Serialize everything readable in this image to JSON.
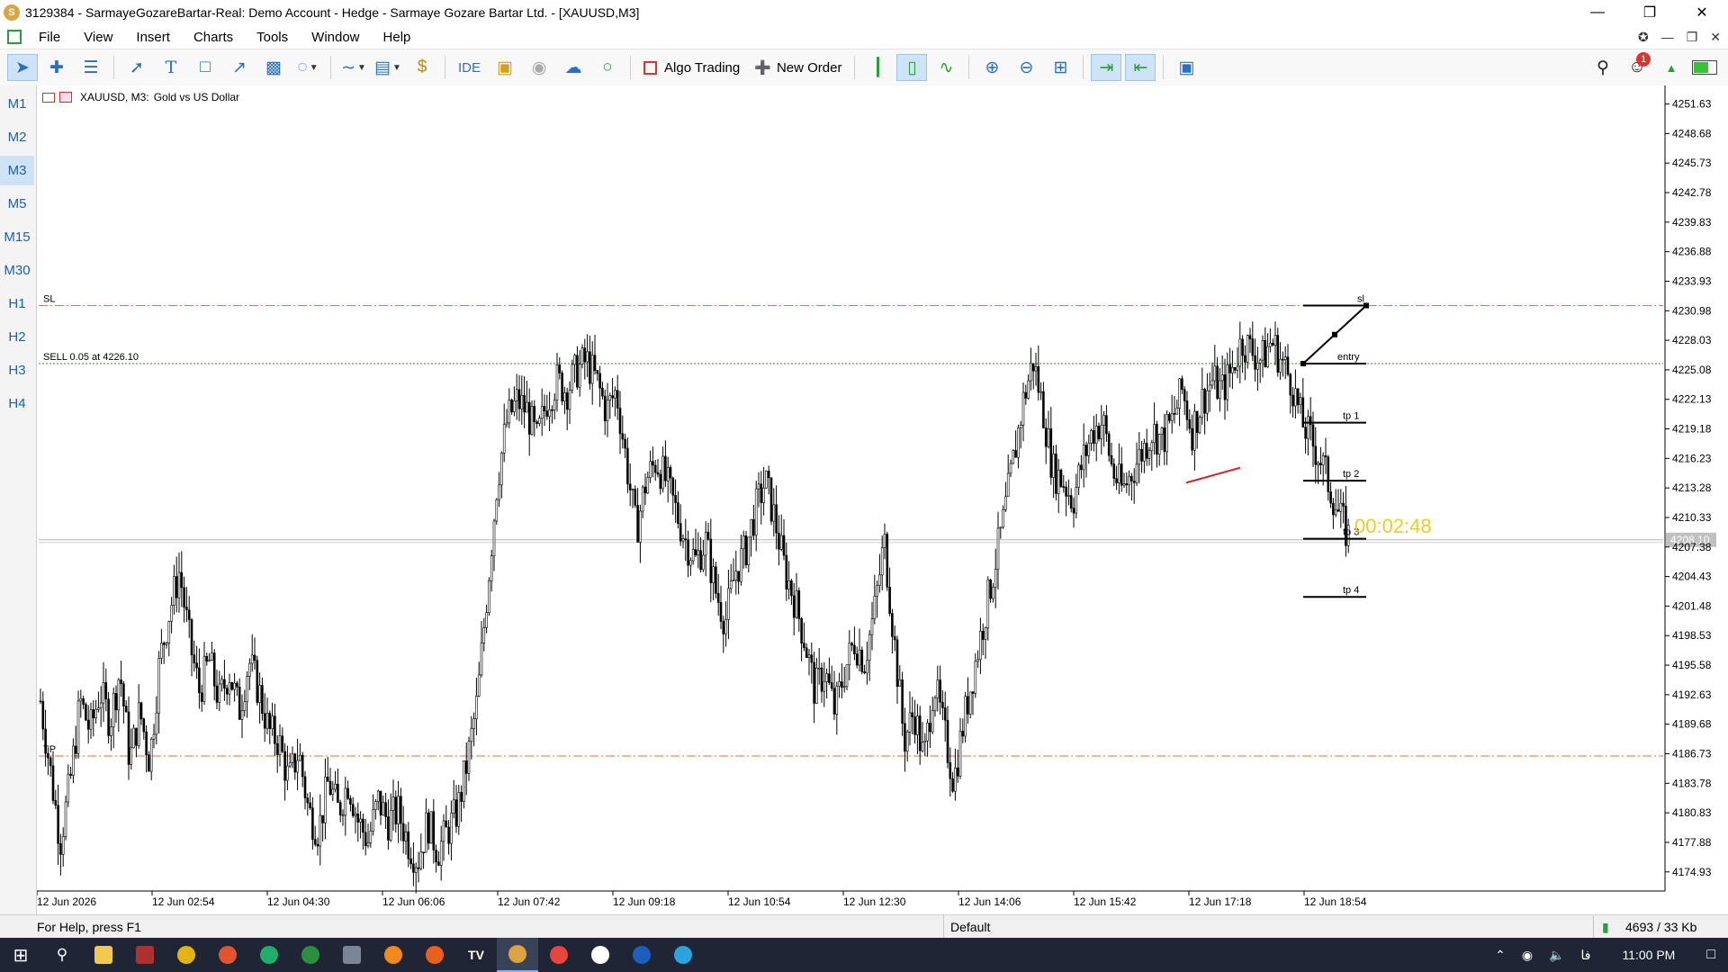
{
  "window": {
    "title": "3129384 - SarmayeGozareBartar-Real: Demo Account - Hedge - Sarmaye Gozare Bartar Ltd. - [XAUUSD,M3]",
    "app_icon": "S"
  },
  "menu": [
    "File",
    "View",
    "Insert",
    "Charts",
    "Tools",
    "Window",
    "Help"
  ],
  "toolbar": {
    "ide_label": "IDE",
    "algo_label": "Algo Trading",
    "order_label": "New Order",
    "notification_count": "1"
  },
  "timeframes": [
    "M1",
    "M2",
    "M3",
    "M5",
    "M15",
    "M30",
    "H1",
    "H2",
    "H3",
    "H4"
  ],
  "active_timeframe": "M3",
  "chart_header": {
    "symbol": "XAUUSD, M3:",
    "description": "Gold vs US Dollar"
  },
  "chart_data": {
    "type": "candlestick",
    "symbol": "XAUUSD",
    "timeframe": "M3",
    "ylim": [
      4173.2,
      4253.3
    ],
    "y_ticks": [
      "4251.63",
      "4248.68",
      "4245.73",
      "4242.78",
      "4239.83",
      "4236.88",
      "4233.93",
      "4230.98",
      "4228.03",
      "4225.08",
      "4222.13",
      "4219.18",
      "4216.23",
      "4213.28",
      "4210.33",
      "4207.38",
      "4204.43",
      "4201.48",
      "4198.53",
      "4195.58",
      "4192.63",
      "4189.68",
      "4186.73",
      "4183.78",
      "4180.83",
      "4177.88",
      "4174.93"
    ],
    "x_ticks": [
      "12 Jun 2026",
      "12 Jun 02:54",
      "12 Jun 04:30",
      "12 Jun 06:06",
      "12 Jun 07:42",
      "12 Jun 09:18",
      "12 Jun 10:54",
      "12 Jun 12:30",
      "12 Jun 14:06",
      "12 Jun 15:42",
      "12 Jun 17:18",
      "12 Jun 18:54"
    ],
    "current_price": "4208.10",
    "bar_countdown": "00:02:48",
    "levels": [
      {
        "label": "SL",
        "price": 4231.5,
        "style": "dashdot",
        "color": "#f26b3a"
      },
      {
        "label": "SELL 0.05 at 4226.10",
        "price": 4225.7,
        "style": "dotted",
        "color": "#2e9a2e"
      },
      {
        "label": "TP",
        "price": 4186.5,
        "style": "dashdot",
        "color": "#f26b3a"
      }
    ],
    "trade_plan_labels": [
      "sl",
      "entry",
      "tp 1",
      "tp 2",
      "tp 3",
      "tp 4"
    ],
    "trade_plan_prices": [
      4231.5,
      4225.7,
      4219.8,
      4214.0,
      4208.2,
      4202.4
    ],
    "price_path": [
      [
        0,
        4192
      ],
      [
        2,
        4185
      ],
      [
        4,
        4178
      ],
      [
        6,
        4184
      ],
      [
        8,
        4192
      ],
      [
        10,
        4189
      ],
      [
        12,
        4193
      ],
      [
        14,
        4190
      ],
      [
        16,
        4195
      ],
      [
        18,
        4186
      ],
      [
        20,
        4191
      ],
      [
        22,
        4186
      ],
      [
        24,
        4196
      ],
      [
        26,
        4201
      ],
      [
        28,
        4205
      ],
      [
        30,
        4198
      ],
      [
        32,
        4193
      ],
      [
        34,
        4196
      ],
      [
        36,
        4192
      ],
      [
        38,
        4195
      ],
      [
        40,
        4191
      ],
      [
        42,
        4196
      ],
      [
        44,
        4193
      ],
      [
        46,
        4189
      ],
      [
        48,
        4188
      ],
      [
        50,
        4184
      ],
      [
        52,
        4187
      ],
      [
        54,
        4181
      ],
      [
        56,
        4179
      ],
      [
        58,
        4184
      ],
      [
        60,
        4181
      ],
      [
        62,
        4184
      ],
      [
        64,
        4180
      ],
      [
        66,
        4178
      ],
      [
        68,
        4182
      ],
      [
        70,
        4180
      ],
      [
        72,
        4181
      ],
      [
        74,
        4178
      ],
      [
        76,
        4176
      ],
      [
        78,
        4180
      ],
      [
        80,
        4177
      ],
      [
        82,
        4179
      ],
      [
        84,
        4181
      ],
      [
        86,
        4186
      ],
      [
        88,
        4192
      ],
      [
        90,
        4203
      ],
      [
        92,
        4214
      ],
      [
        94,
        4220
      ],
      [
        96,
        4222
      ],
      [
        98,
        4221
      ],
      [
        100,
        4218
      ],
      [
        102,
        4222
      ],
      [
        104,
        4224
      ],
      [
        106,
        4223
      ],
      [
        108,
        4225
      ],
      [
        110,
        4226
      ],
      [
        112,
        4224
      ],
      [
        114,
        4221
      ],
      [
        116,
        4223
      ],
      [
        118,
        4216
      ],
      [
        120,
        4209
      ],
      [
        122,
        4214
      ],
      [
        124,
        4216
      ],
      [
        126,
        4214
      ],
      [
        128,
        4211
      ],
      [
        130,
        4208
      ],
      [
        132,
        4206
      ],
      [
        134,
        4208
      ],
      [
        136,
        4203
      ],
      [
        138,
        4200
      ],
      [
        140,
        4205
      ],
      [
        142,
        4207
      ],
      [
        144,
        4211
      ],
      [
        146,
        4214
      ],
      [
        148,
        4210
      ],
      [
        150,
        4205
      ],
      [
        152,
        4202
      ],
      [
        154,
        4198
      ],
      [
        156,
        4193
      ],
      [
        158,
        4195
      ],
      [
        160,
        4191
      ],
      [
        162,
        4195
      ],
      [
        164,
        4198
      ],
      [
        166,
        4196
      ],
      [
        168,
        4201
      ],
      [
        170,
        4208
      ],
      [
        172,
        4198
      ],
      [
        174,
        4188
      ],
      [
        176,
        4191
      ],
      [
        178,
        4186
      ],
      [
        180,
        4194
      ],
      [
        182,
        4189
      ],
      [
        184,
        4184
      ],
      [
        186,
        4190
      ],
      [
        188,
        4195
      ],
      [
        190,
        4200
      ],
      [
        192,
        4205
      ],
      [
        194,
        4210
      ],
      [
        196,
        4216
      ],
      [
        198,
        4222
      ],
      [
        200,
        4226
      ],
      [
        202,
        4221
      ],
      [
        204,
        4215
      ],
      [
        206,
        4214
      ],
      [
        208,
        4212
      ],
      [
        210,
        4216
      ],
      [
        212,
        4219
      ],
      [
        214,
        4220
      ],
      [
        216,
        4215
      ],
      [
        218,
        4213
      ],
      [
        220,
        4215
      ],
      [
        222,
        4217
      ],
      [
        224,
        4219
      ],
      [
        226,
        4218
      ],
      [
        228,
        4220
      ],
      [
        230,
        4223
      ],
      [
        232,
        4219
      ],
      [
        234,
        4222
      ],
      [
        236,
        4224
      ],
      [
        238,
        4223
      ],
      [
        240,
        4225
      ],
      [
        242,
        4228
      ],
      [
        244,
        4227
      ],
      [
        246,
        4226
      ],
      [
        248,
        4228
      ],
      [
        250,
        4226
      ],
      [
        252,
        4224
      ],
      [
        254,
        4220
      ],
      [
        256,
        4218
      ],
      [
        258,
        4216
      ],
      [
        260,
        4213
      ],
      [
        262,
        4210
      ],
      [
        264,
        4208
      ]
    ]
  },
  "status": {
    "help": "For Help, press F1",
    "profile": "Default",
    "traffic": "4693 / 33 Kb"
  },
  "taskbar": {
    "time": "11:00 PM",
    "lang": "فا"
  }
}
